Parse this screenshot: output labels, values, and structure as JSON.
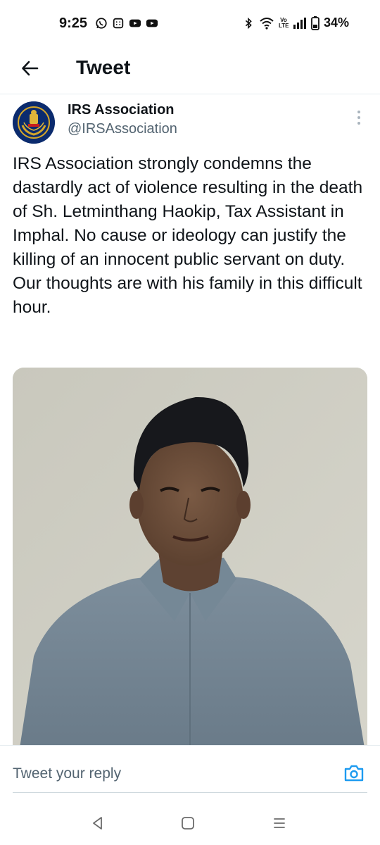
{
  "status_bar": {
    "time": "9:25",
    "battery": "34%",
    "left_icons": [
      "whatsapp-icon",
      "sim-toolkit-icon",
      "youtube-icon",
      "youtube-icon"
    ],
    "right_icons": [
      "bluetooth-icon",
      "wifi-icon",
      "volte-icon",
      "signal-icon",
      "battery-icon"
    ],
    "volte_text": "Vo LTE"
  },
  "header": {
    "title": "Tweet",
    "back_icon": "arrow-left-icon"
  },
  "tweet": {
    "author_name": "IRS Association",
    "author_handle": "@IRSAssociation",
    "more_icon": "more-vertical-icon",
    "text": "IRS Association strongly condemns the dastardly act of violence resulting in the death of Sh. Letminthang Haokip, Tax Assistant in Imphal. No cause or ideology can justify the killing of an innocent public servant on duty. Our thoughts are with his family in this difficult hour.",
    "photo_icon": "photo-portrait"
  },
  "reply": {
    "placeholder": "Tweet your reply",
    "camera_icon": "camera-icon",
    "accent": "#1d9bf0"
  },
  "nav": {
    "back_icon": "nav-back-icon",
    "home_icon": "nav-home-icon",
    "recents_icon": "nav-recents-icon"
  }
}
